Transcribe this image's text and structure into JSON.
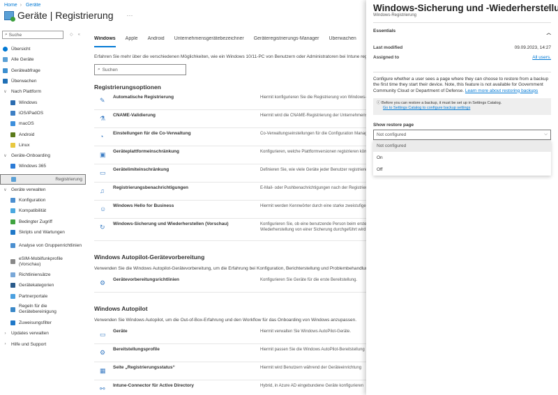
{
  "breadcrumb": [
    "Home",
    "Geräte"
  ],
  "page_title": "Geräte | Registrierung",
  "sidebar": {
    "search_placeholder": "Suche",
    "items": [
      {
        "label": "Übersicht",
        "icon": "info-icon",
        "color": "#0078d4",
        "level": 0
      },
      {
        "label": "Alle Geräte",
        "icon": "devices-icon",
        "color": "#5aa0d6",
        "level": 0
      },
      {
        "label": "Geräteabfrage",
        "icon": "query-icon",
        "color": "#3c8fd0",
        "level": 0
      },
      {
        "label": "Überwachen",
        "icon": "monitor-icon",
        "color": "#1f6fb5",
        "level": 0
      },
      {
        "label": "Nach Plattform",
        "chevron": "v",
        "level": 0
      },
      {
        "label": "Windows",
        "icon": "windows-icon",
        "color": "#2b6cb0",
        "level": 1
      },
      {
        "label": "iOS/iPadOS",
        "icon": "ios-icon",
        "color": "#3d7fc4",
        "level": 1
      },
      {
        "label": "macOS",
        "icon": "macos-icon",
        "color": "#3d8fdc",
        "level": 1
      },
      {
        "label": "Android",
        "icon": "android-icon",
        "color": "#5a7a1a",
        "level": 1
      },
      {
        "label": "Linux",
        "icon": "linux-icon",
        "color": "#e8c840",
        "level": 1
      },
      {
        "label": "Geräte-Onboarding",
        "chevron": "v",
        "level": 0
      },
      {
        "label": "Windows 365",
        "icon": "windows365-icon",
        "color": "#2b7bd6",
        "level": 1
      },
      {
        "label": "Registrierung",
        "icon": "enrollment-icon",
        "color": "#5aa0d6",
        "level": 1,
        "selected": true
      },
      {
        "label": "Geräte verwalten",
        "chevron": "v",
        "level": 0
      },
      {
        "label": "Konfiguration",
        "icon": "configuration-icon",
        "color": "#4b8fd0",
        "level": 1
      },
      {
        "label": "Kompatibilität",
        "icon": "compliance-icon",
        "color": "#4aa8e0",
        "level": 1
      },
      {
        "label": "Bedingter Zugriff",
        "icon": "conditional-access-icon",
        "color": "#3fa33f",
        "level": 1
      },
      {
        "label": "Skripts und Wartungen",
        "icon": "scripts-icon",
        "color": "#1f78c8",
        "level": 1
      },
      {
        "label": "Analyse von Gruppenrichtlinien",
        "icon": "gpo-analytics-icon",
        "color": "#4b8fd0",
        "level": 1,
        "two": true
      },
      {
        "label": "eSIM-Mobilfunkprofile (Vorschau)",
        "icon": "esim-icon",
        "color": "#888888",
        "level": 1,
        "two": true
      },
      {
        "label": "Richtliniensätze",
        "icon": "policy-sets-icon",
        "color": "#7aa8d8",
        "level": 1
      },
      {
        "label": "Gerätekategorien",
        "icon": "categories-icon",
        "color": "#2a5a8a",
        "level": 1
      },
      {
        "label": "Partnerportale",
        "icon": "partner-portals-icon",
        "color": "#4aa0e0",
        "level": 1
      },
      {
        "label": "Regeln für die Gerätebereinigung",
        "icon": "cleanup-rules-icon",
        "color": "#3a88c8",
        "level": 1,
        "two": true
      },
      {
        "label": "Zuweisungsfilter",
        "icon": "filter-icon",
        "color": "#1f78c8",
        "level": 1
      },
      {
        "label": "Updates verwalten",
        "chevron": ">",
        "level": 0
      },
      {
        "label": "Hilfe und Support",
        "chevron": ">",
        "level": 0
      }
    ]
  },
  "main": {
    "tabs": [
      "Windows",
      "Apple",
      "Android",
      "Unternehmensgerätebezeichner",
      "Geräteregistrierungs-Manager",
      "Überwachen"
    ],
    "description": "Erfahren Sie mehr über die verschiedenen Möglichkeiten, wie ein Windows 10/11-PC von Benutzern oder Administratoren bei Intune registriert werden kann.",
    "search_placeholder": "Suchen",
    "sections": [
      {
        "title": "Registrierungsoptionen",
        "rows": [
          {
            "icon": "✎",
            "name": "Automatische Registrierung",
            "desc": "Hiermit konfigurieren Sie die Registrierung von Windows-Geräten"
          },
          {
            "icon": "⚗",
            "name": "CNAME-Validierung",
            "desc": "Hiermit wird die CNAME-Registrierung der Unternehmensdomäne"
          },
          {
            "icon": "◔",
            "name": "Einstellungen für die Co-Verwaltung",
            "desc": "Co-Verwaltungseinstellungen für die Configuration Manager"
          },
          {
            "icon": "▣",
            "name": "Geräteplattformeinschränkung",
            "desc": "Konfigurieren, welche Plattformversionen registrieren können"
          },
          {
            "icon": "▭",
            "name": "Gerätelimiteinschränkung",
            "desc": "Definieren Sie, wie viele Geräte jeder Benutzer registrieren"
          },
          {
            "icon": "♫",
            "name": "Registrierungsbenachrichtigungen",
            "desc": "E-Mail- oder Pushbenachrichtigungen nach der Registrierung"
          },
          {
            "icon": "☺",
            "name": "Windows Hello for Business",
            "desc": "Hiermit werden Kennwörter durch eine starke zweistufige"
          },
          {
            "icon": "↻",
            "name": "Windows-Sicherung und Wiederherstellen (Vorschau)",
            "desc": "Konfigurieren Sie, ob eine benutzende Person beim ersten",
            "desc2": "Wiederherstellung von einer Sicherung durchgeführt wird"
          }
        ]
      },
      {
        "title": "Windows Autopilot-Gerätevorbereitung",
        "desc": "Verwenden Sie die Windows Autopilot-Gerätevorbereitung, um die Erfahrung bei Konfiguration, Berichterstellung und Problembehandlung",
        "rows": [
          {
            "icon": "⚙",
            "name": "Gerätevorbereitungsrichtlinien",
            "desc": "Konfigurieren Sie Geräte für die erste Bereitstellung."
          }
        ]
      },
      {
        "title": "Windows Autopilot",
        "desc": "Verwenden Sie Windows Autopilot, um die Out-of-Box-Erfahrung und den Workflow für das Onboarding von Windows anzupassen.",
        "rows": [
          {
            "icon": "▭",
            "name": "Geräte",
            "desc": "Hiermit verwalten Sie Windows AutoPilot-Geräte."
          },
          {
            "icon": "⚙",
            "name": "Bereitstellungsprofile",
            "desc": "Hiermit passen Sie die Windows AutoPilot-Bereitstellung"
          },
          {
            "icon": "▦",
            "name": "Seite „Registrierungsstatus“",
            "desc": "Hiermit wird Benutzern während der Geräteeinrichtung"
          },
          {
            "icon": "⚯",
            "name": "Intune-Connector für Active Directory",
            "desc": "Hybrid, in Azure AD eingebundene Geräte konfigurieren"
          }
        ]
      }
    ]
  },
  "panel": {
    "title": "Windows-Sicherung und -Wiederherstellun...",
    "subtitle": "Windows-Registrierung",
    "essentials": "Essentials",
    "last_modified_label": "Last modified",
    "last_modified_value": "09.09.2023, 14:27",
    "assigned_label": "Assigned to",
    "assigned_value": "All users.",
    "paragraph": "Configure whether a user sees a page where they can choose to restore from a backup the first time they start their device. Note, this feature is not available for Government Community Cloud or Department of Defense.",
    "learn_more": "Learn more about restoring backups",
    "info_text": "Before you can restore a backup, it must be set up in Settings Catalog.",
    "info_link": "Go to Settings Catalog to configure backup settings",
    "field_label": "Show restore page",
    "selected": "Not configured",
    "options": [
      "Not configured",
      "On",
      "Off"
    ]
  }
}
